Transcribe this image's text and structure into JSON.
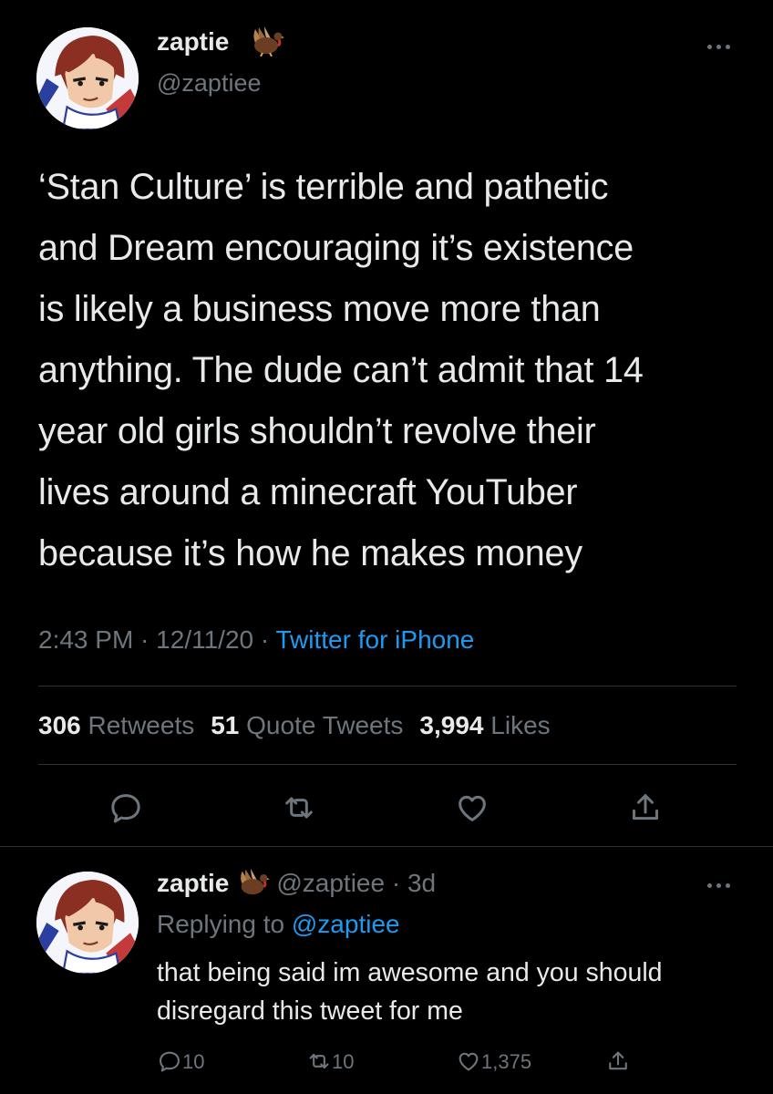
{
  "main_tweet": {
    "display_name": "zaptie",
    "badge_icon": "turkey-emoji-icon",
    "handle": "@zaptiee",
    "text": "‘Stan Culture’ is terrible and pathetic\nand Dream encouraging it’s existence\nis likely a business move more than\nanything. The dude can’t admit that 14\nyear old girls shouldn’t revolve their\nlives around a minecraft YouTuber\nbecause it’s how he makes money",
    "time": "2:43 PM",
    "sep1": " · ",
    "date": "12/11/20",
    "sep2": " · ",
    "source": "Twitter for iPhone",
    "stats": {
      "retweets_count": "306",
      "retweets_label": "Retweets",
      "quotes_count": "51",
      "quotes_label": "Quote Tweets",
      "likes_count": "3,994",
      "likes_label": "Likes"
    },
    "actions": [
      "reply-icon",
      "retweet-icon",
      "like-icon",
      "share-icon"
    ]
  },
  "reply_tweet": {
    "display_name": "zaptie",
    "badge_icon": "turkey-emoji-icon",
    "handle": "@zaptiee",
    "dot": " · ",
    "time": "3d",
    "replying_prefix": "Replying to ",
    "replying_to": "@zaptiee",
    "text": "that being said im awesome and you should disregard this tweet for me",
    "replies": "10",
    "retweets": "10",
    "likes": "1,375"
  },
  "colors": {
    "background": "#000000",
    "text": "#e7e9ea",
    "secondary": "#6e767d",
    "accent": "#1d9bf0",
    "divider": "#2f3336"
  }
}
